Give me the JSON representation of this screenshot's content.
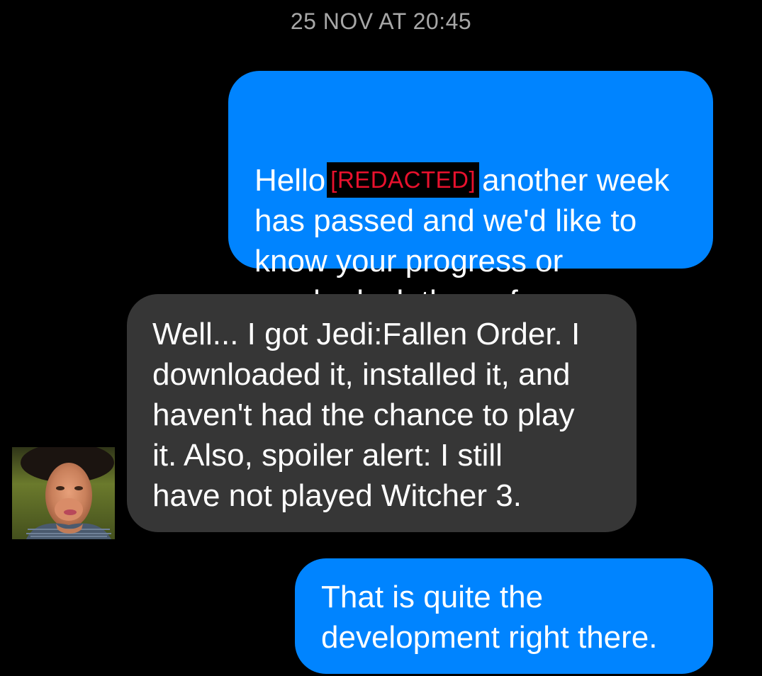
{
  "conversation": {
    "timestamp": "25 NOV AT 20:45",
    "messages": [
      {
        "direction": "outgoing",
        "lines": [
          {
            "before": "Hello",
            "redacted": "[REDACTED]",
            "after": "another week"
          },
          {
            "text": "has passed and we'd like to"
          },
          {
            "text": "know your progress or"
          },
          {
            "text": "maybe lack thereof"
          }
        ]
      },
      {
        "direction": "incoming",
        "lines": [
          {
            "text": "Well... I got Jedi:Fallen Order. I"
          },
          {
            "text": "downloaded it, installed it, and"
          },
          {
            "text": "haven't had the chance to play"
          },
          {
            "text": "it. Also, spoiler alert: I still"
          },
          {
            "text": "have not played Witcher 3."
          }
        ]
      },
      {
        "direction": "outgoing",
        "lines": [
          {
            "text": "That is quite the"
          },
          {
            "text": "development right there."
          }
        ]
      }
    ]
  },
  "colors": {
    "background": "#000000",
    "outgoing_bubble": "#0084ff",
    "incoming_bubble": "#363636",
    "timestamp_text": "#a7a7a7",
    "redacted_text": "#e8112d"
  },
  "icons": {
    "avatar": "contact-avatar-photo"
  }
}
